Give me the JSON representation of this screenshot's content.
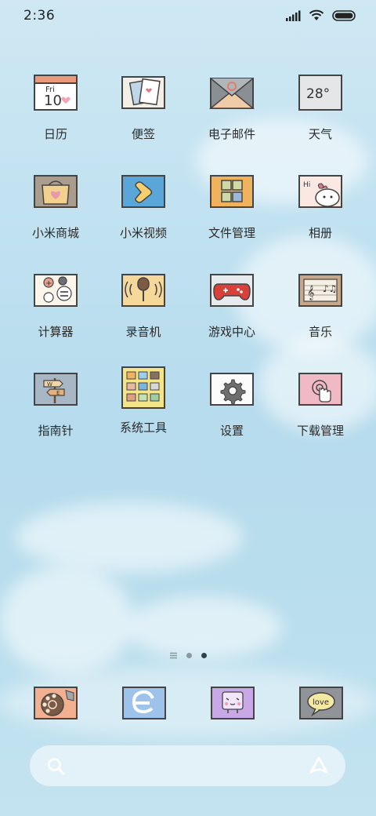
{
  "status_bar": {
    "time": "2:36",
    "icons": [
      "signal-icon",
      "wifi-icon",
      "battery-icon"
    ]
  },
  "apps": [
    {
      "label": "日历",
      "icon": "calendar-icon",
      "icon_text": "10",
      "icon_subtext": "Fri"
    },
    {
      "label": "便签",
      "icon": "notes-icon"
    },
    {
      "label": "电子邮件",
      "icon": "email-icon"
    },
    {
      "label": "天气",
      "icon": "weather-icon",
      "icon_text": "28°"
    },
    {
      "label": "小米商城",
      "icon": "store-icon"
    },
    {
      "label": "小米视频",
      "icon": "video-icon"
    },
    {
      "label": "文件管理",
      "icon": "file-manager-icon"
    },
    {
      "label": "相册",
      "icon": "gallery-icon",
      "icon_text": "Hi"
    },
    {
      "label": "计算器",
      "icon": "calculator-icon"
    },
    {
      "label": "录音机",
      "icon": "recorder-icon"
    },
    {
      "label": "游戏中心",
      "icon": "game-center-icon"
    },
    {
      "label": "音乐",
      "icon": "music-icon"
    },
    {
      "label": "指南针",
      "icon": "compass-icon",
      "icon_text": "W",
      "icon_subtext": "E"
    },
    {
      "label": "系统工具",
      "icon": "system-tools-icon"
    },
    {
      "label": "设置",
      "icon": "settings-icon"
    },
    {
      "label": "下载管理",
      "icon": "download-manager-icon"
    }
  ],
  "pager": {
    "pages": 2,
    "current": 2
  },
  "dock": [
    {
      "icon": "phone-icon"
    },
    {
      "icon": "browser-icon"
    },
    {
      "icon": "assistant-icon"
    },
    {
      "icon": "messages-icon",
      "icon_text": "love"
    }
  ],
  "search": {
    "icon": "search-icon",
    "action_icon": "app-vault-icon"
  }
}
